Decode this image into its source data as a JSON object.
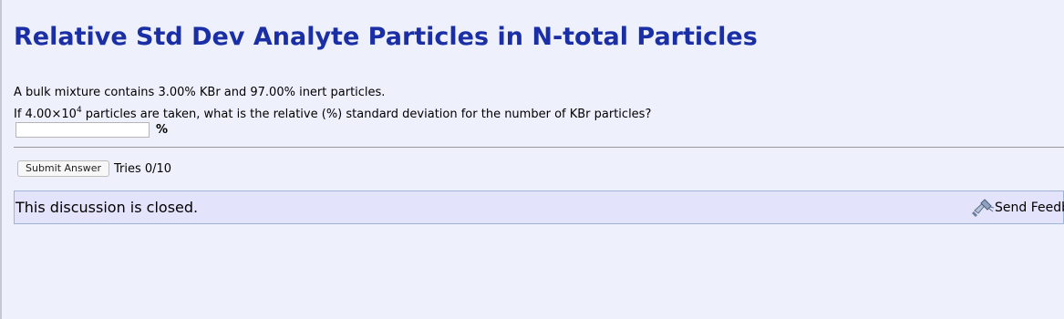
{
  "title": "Relative Std Dev Analyte Particles in N-total Particles",
  "problem": {
    "line1": "A bulk mixture contains 3.00% KBr and 97.00% inert particles.",
    "line2_prefix": "If 4.00×10",
    "line2_exponent": "4",
    "line2_suffix": " particles are taken, what is the relative (%) standard deviation for the number of KBr particles?"
  },
  "answer": {
    "value": "",
    "placeholder": "",
    "unit": "%"
  },
  "controls": {
    "submit_label": "Submit Answer",
    "tries": "Tries 0/10"
  },
  "discussion": {
    "status_text": "This discussion is closed.",
    "feedback_label": "Send Feedback",
    "feedback_icon": "feedback-megaphone-icon"
  },
  "colors": {
    "title": "#1a2fa6",
    "background": "#eef0fb",
    "discussion_bar": "#e3e3fb"
  }
}
